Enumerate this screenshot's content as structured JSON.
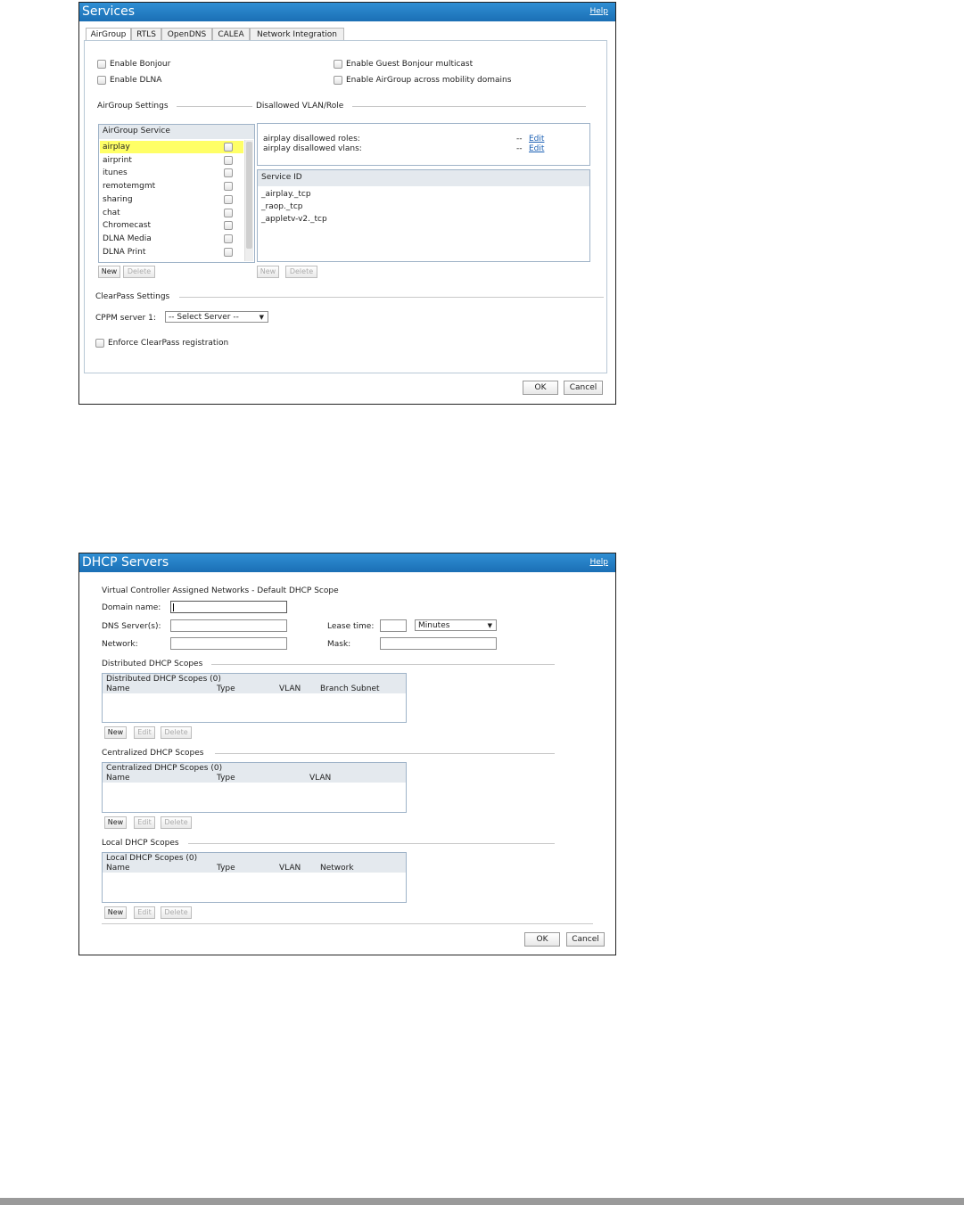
{
  "services": {
    "title": "Services",
    "help": "Help",
    "tabs": [
      "AirGroup",
      "RTLS",
      "OpenDNS",
      "CALEA",
      "Network Integration"
    ],
    "enable_bonjour": "Enable Bonjour",
    "enable_dlna": "Enable DLNA",
    "enable_guest_bonjour": "Enable Guest Bonjour multicast",
    "enable_airgroup_mobility": "Enable AirGroup across mobility domains",
    "airgroup_settings": "AirGroup Settings",
    "disallowed_vlan_role": "Disallowed VLAN/Role",
    "service_list_header": "AirGroup Service",
    "services": [
      "airplay",
      "airprint",
      "itunes",
      "remotemgmt",
      "sharing",
      "chat",
      "Chromecast",
      "DLNA Media",
      "DLNA Print"
    ],
    "selected_service": "airplay",
    "disallowed_roles_label": "airplay disallowed roles:",
    "disallowed_vlans_label": "airplay disallowed vlans:",
    "dash": "--",
    "edit": "Edit",
    "service_id_header": "Service ID",
    "service_ids": [
      "_airplay._tcp",
      "_raop._tcp",
      "_appletv-v2._tcp"
    ],
    "new": "New",
    "delete": "Delete",
    "clearpass_settings": "ClearPass Settings",
    "cppm_label": "CPPM server 1:",
    "cppm_value": "-- Select Server --",
    "enforce_clearpass": "Enforce ClearPass registration",
    "ok": "OK",
    "cancel": "Cancel"
  },
  "dhcp": {
    "title": "DHCP Servers",
    "help": "Help",
    "subtitle": "Virtual Controller Assigned Networks - Default DHCP Scope",
    "domain_name": "Domain name:",
    "dns_servers": "DNS Server(s):",
    "lease_time": "Lease time:",
    "lease_unit": "Minutes",
    "network": "Network:",
    "mask": "Mask:",
    "distributed": {
      "section": "Distributed DHCP Scopes",
      "box_title": "Distributed DHCP Scopes (0)",
      "columns": [
        "Name",
        "Type",
        "VLAN",
        "Branch Subnet"
      ]
    },
    "centralized": {
      "section": "Centralized DHCP Scopes",
      "box_title": "Centralized DHCP Scopes (0)",
      "columns": [
        "Name",
        "Type",
        "VLAN"
      ]
    },
    "local": {
      "section": "Local DHCP Scopes",
      "box_title": "Local DHCP Scopes (0)",
      "columns": [
        "Name",
        "Type",
        "VLAN",
        "Network"
      ]
    },
    "new": "New",
    "edit": "Edit",
    "delete": "Delete",
    "ok": "OK",
    "cancel": "Cancel"
  }
}
